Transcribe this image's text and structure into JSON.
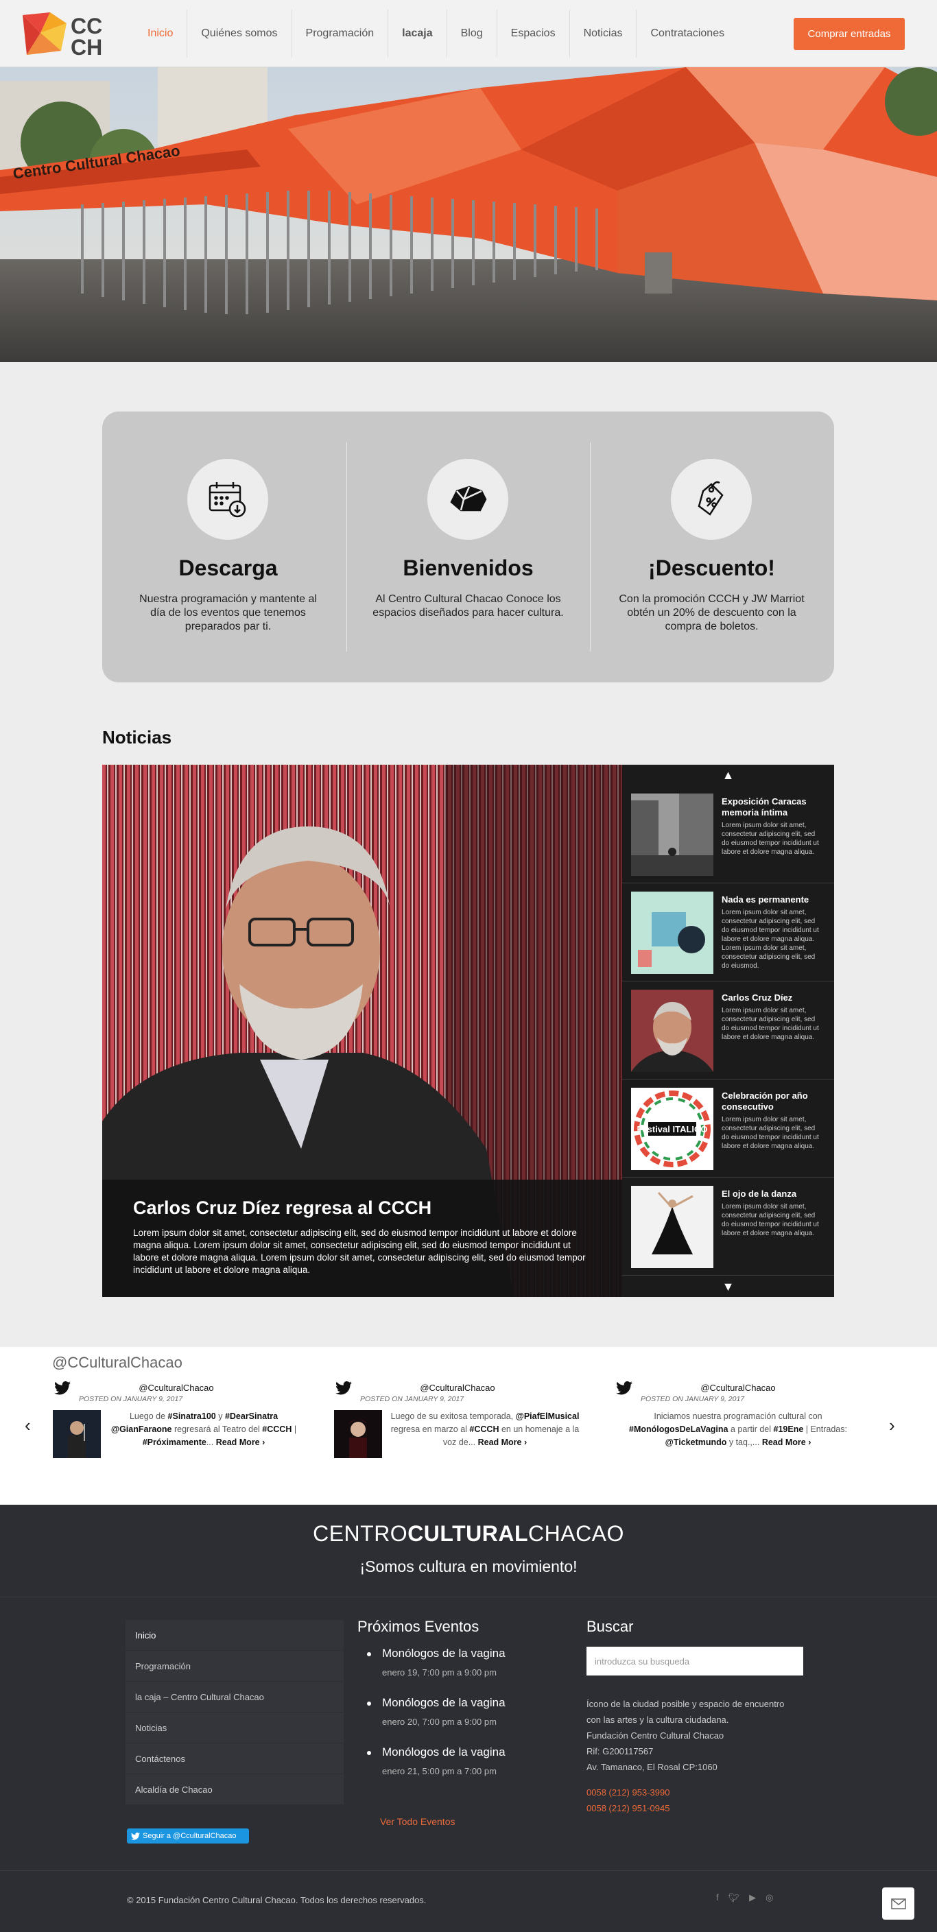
{
  "header": {
    "logo_text": "CCCH",
    "nav": [
      "Inicio",
      "Quiénes somos",
      "Programación",
      "lacaja",
      "Blog",
      "Espacios",
      "Noticias",
      "Contrataciones"
    ],
    "buy_label": "Comprar entradas",
    "accent": "#ef6a36"
  },
  "hero": {
    "sign_text": "Centro Cultural Chacao"
  },
  "features": [
    {
      "icon": "calendar-download-icon",
      "title": "Descarga",
      "text": "Nuestra programación y mantente al día de los eventos que tenemos preparados par ti."
    },
    {
      "icon": "building-icon",
      "title": "Bienvenidos",
      "text": "Al Centro Cultural Chacao Conoce los espacios diseñados para hacer cultura."
    },
    {
      "icon": "discount-tag-icon",
      "title": "¡Descuento!",
      "text": "Con la promoción CCCH y JW Marriot obtén un 20% de descuento con la compra de boletos."
    }
  ],
  "news": {
    "section_title": "Noticias",
    "main_title": "Carlos Cruz Díez regresa al CCCH",
    "main_text": "Lorem ipsum dolor sit amet, consectetur adipiscing elit, sed do eiusmod tempor incididunt ut labore et dolore magna aliqua. Lorem ipsum dolor sit amet, consectetur adipiscing elit, sed do eiusmod tempor incididunt ut labore et dolore magna aliqua. Lorem ipsum dolor sit amet, consectetur adipiscing elit, sed do eiusmod tempor incididunt ut labore et dolore magna aliqua.",
    "side_items": [
      {
        "title": "Exposición Caracas memoria íntima",
        "text": "Lorem ipsum dolor sit amet, consectetur adipiscing elit, sed do eiusmod tempor incididunt ut labore et dolore magna aliqua."
      },
      {
        "title": "Nada es permanente",
        "text": "Lorem ipsum dolor sit amet, consectetur adipiscing elit, sed do eiusmod tempor incididunt ut labore et dolore magna aliqua. Lorem ipsum dolor sit amet, consectetur adipiscing elit, sed do eiusmod."
      },
      {
        "title": "Carlos Cruz Díez",
        "text": "Lorem ipsum dolor sit amet, consectetur adipiscing elit, sed do eiusmod tempor incididunt ut labore et dolore magna aliqua."
      },
      {
        "title": "Celebración por año consecutivo",
        "text": "Lorem ipsum dolor sit amet, consectetur adipiscing elit, sed do eiusmod tempor incididunt ut labore et dolore magna aliqua."
      },
      {
        "title": "El ojo de la danza",
        "text": "Lorem ipsum dolor sit amet, consectetur adipiscing elit, sed do eiusmod tempor incididunt ut labore et dolore magna aliqua."
      }
    ],
    "festival_text": "Festival ITALICO"
  },
  "twitter": {
    "handle": "@CCulturalChacao",
    "tweets": [
      {
        "user": "@CculturalChacao",
        "date": "POSTED ON JANUARY 9, 2017",
        "text_html": "Luego de <b>#Sinatra100</b> y <b>#DearSinatra</b> <b>@GianFaraone</b> regresará al Teatro del <b>#CCCH</b> | <b>#Próximamente</b>... <b>Read More ›</b>"
      },
      {
        "user": "@CculturalChacao",
        "date": "POSTED ON JANUARY 9, 2017",
        "text_html": "Luego de su exitosa temporada, <b>@PiafElMusical</b> regresa en marzo al <b>#CCCH</b> en un homenaje a la voz de... <b>Read More ›</b>"
      },
      {
        "user": "@CculturalChacao",
        "date": "POSTED ON JANUARY 9, 2017",
        "text_html": "Iniciamos nuestra programación cultural con <b>#MonólogosDeLaVagina</b> a partir del <b>#19Ene</b> | Entradas: <b>@Ticketmundo</b> y taq.,... <b>Read More ›</b>"
      }
    ]
  },
  "footer": {
    "brand_a": "CENTRO",
    "brand_b": "CULTURAL",
    "brand_c": "CHACAO",
    "slogan": "¡Somos cultura en movimiento!",
    "menu": [
      "Inicio",
      "Programación",
      "la caja – Centro Cultural Chacao",
      "Noticias",
      "Contáctenos",
      "Alcaldía de Chacao"
    ],
    "follow_label": "Seguir a @CculturalChacao",
    "events_title": "Próximos Eventos",
    "events": [
      {
        "title": "Monólogos de la vagina",
        "date": "enero 19, 7:00 pm a 9:00 pm"
      },
      {
        "title": "Monólogos de la vagina",
        "date": "enero 20, 7:00 pm a 9:00 pm"
      },
      {
        "title": "Monólogos de la vagina",
        "date": "enero 21, 5:00 pm a 7:00 pm"
      }
    ],
    "events_all": "Ver Todo Eventos",
    "search_title": "Buscar",
    "search_placeholder": "introduzca su busqueda",
    "address": [
      "Ícono de la ciudad posible y espacio de encuentro",
      "con las artes y la cultura ciudadana.",
      "Fundación Centro Cultural Chacao",
      "Rif: G200117567",
      "Av. Tamanaco, El Rosal CP:1060"
    ],
    "phones": [
      "0058 (212) 953-3990",
      "0058 (212) 951-0945"
    ],
    "copyright": "© 2015 Fundación Centro Cultural Chacao. Todos los derechos reservados."
  }
}
